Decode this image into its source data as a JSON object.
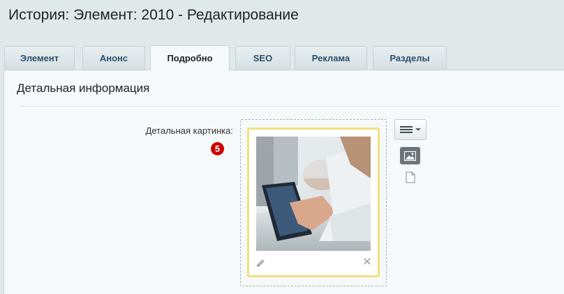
{
  "header": {
    "title": "История: Элемент: 2010 - Редактирование"
  },
  "tabs": [
    {
      "label": "Элемент",
      "active": false
    },
    {
      "label": "Анонс",
      "active": false
    },
    {
      "label": "Подробно",
      "active": true
    },
    {
      "label": "SEO",
      "active": false
    },
    {
      "label": "Реклама",
      "active": false
    },
    {
      "label": "Разделы",
      "active": false
    }
  ],
  "section": {
    "title": "Детальная информация"
  },
  "field": {
    "label": "Детальная картинка:",
    "badge": "5"
  },
  "icons": {
    "edit": "pencil-icon",
    "remove": "close-icon",
    "menu": "hamburger-menu-icon",
    "image_mode": "image-icon",
    "file_mode": "document-icon"
  },
  "colors": {
    "background": "#e0e8ea",
    "panel": "#f5f9f9",
    "tab_text": "#2a5069",
    "badge": "#cc0000",
    "frame_border": "#f3df7f"
  }
}
